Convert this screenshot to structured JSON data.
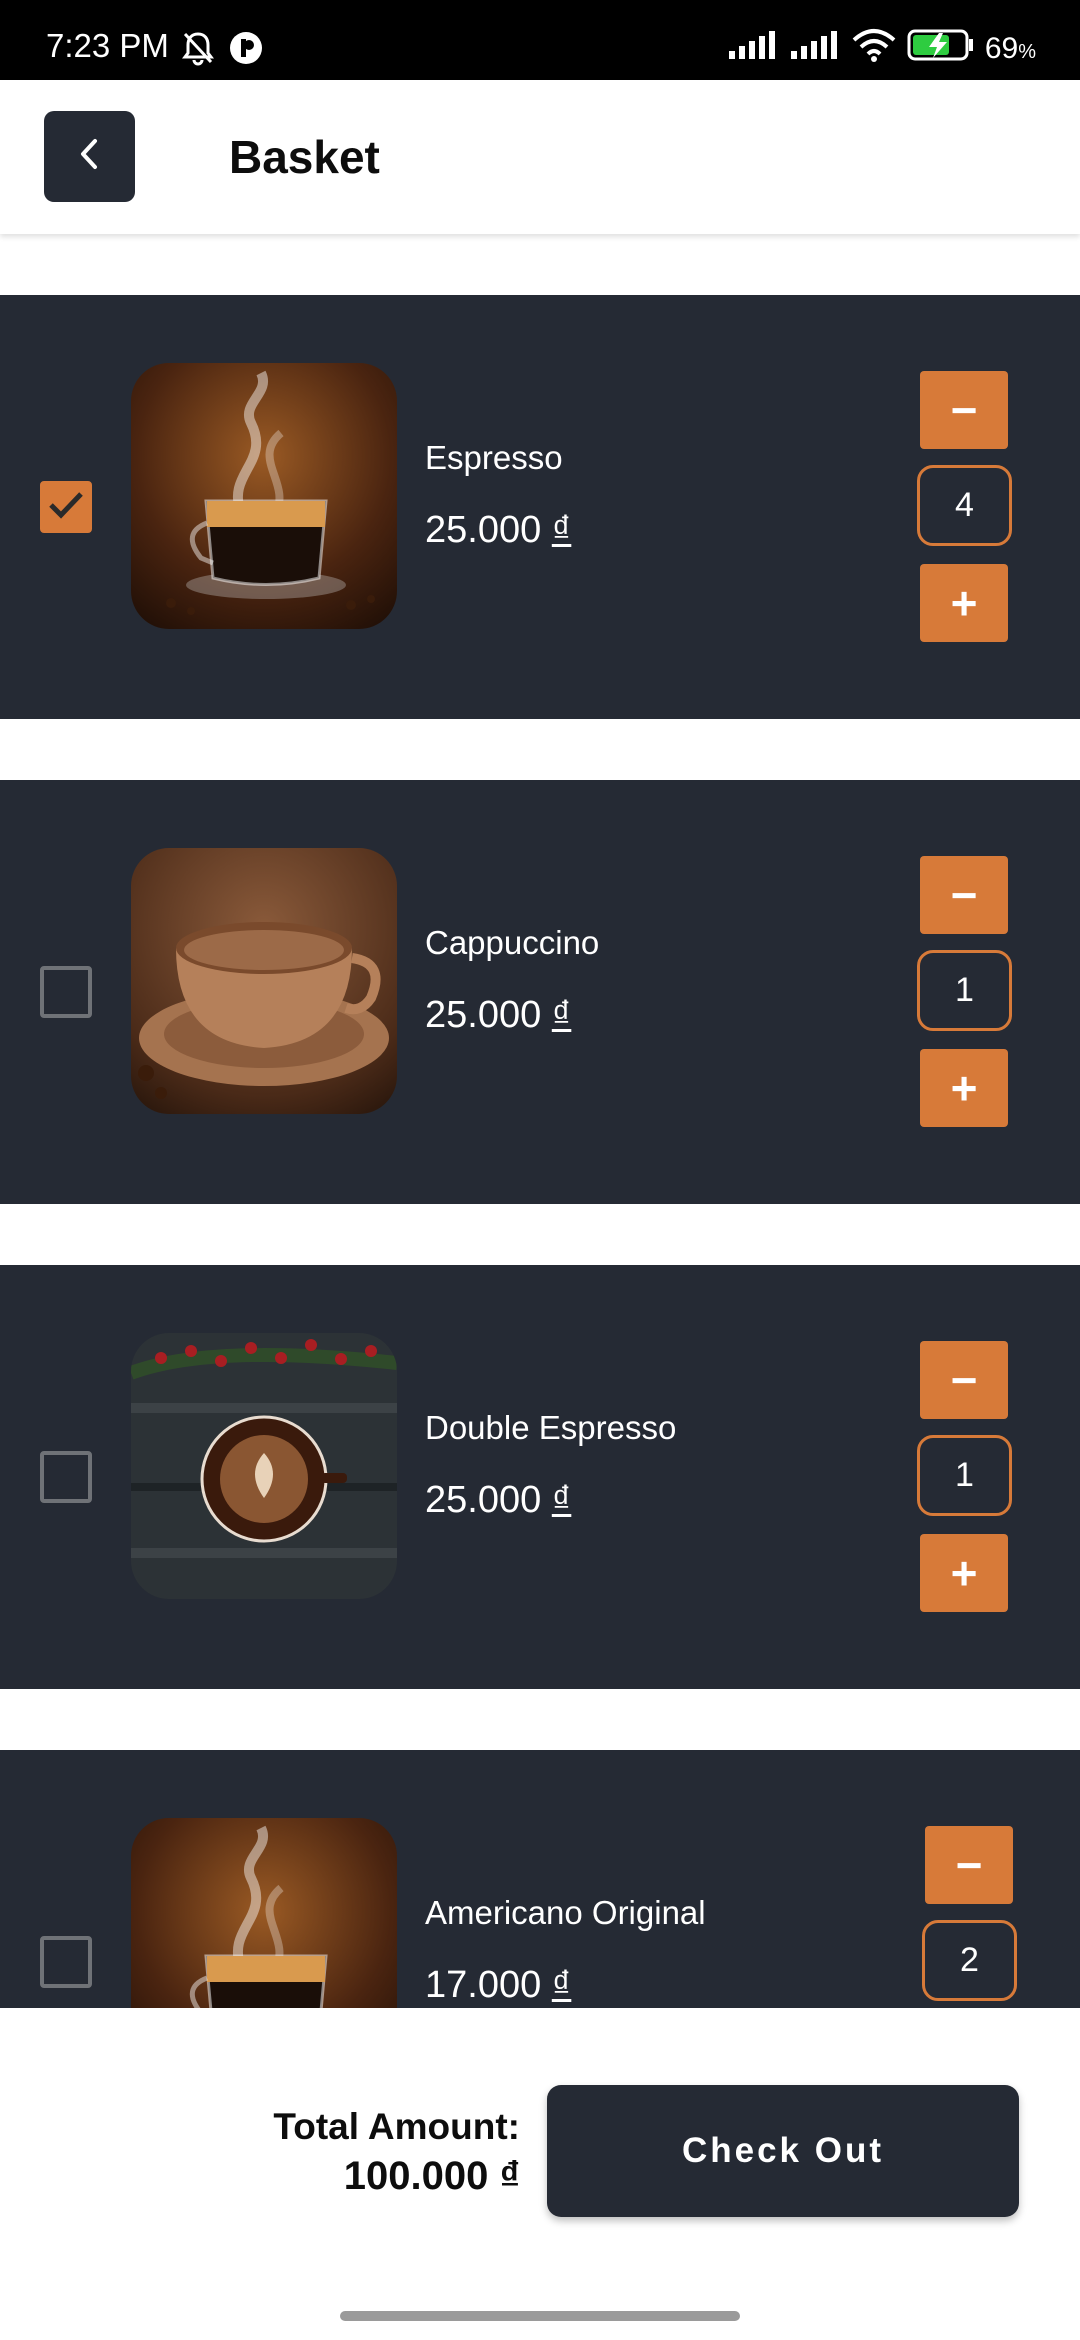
{
  "status_bar": {
    "time": "7:23 PM",
    "battery_percent": "69",
    "battery_unit": "%",
    "icons": [
      "bell-off-icon",
      "app-notification-icon",
      "signal-icon",
      "signal-icon",
      "wifi-icon",
      "battery-charging-icon"
    ]
  },
  "header": {
    "title": "Basket",
    "back_icon": "chevron-left-icon"
  },
  "colors": {
    "accent": "#d77a39",
    "card_background": "#252a34",
    "text_light": "#ffffff",
    "text_dark": "#0d0d0d"
  },
  "items": [
    {
      "name": "Espresso",
      "price": "25.000",
      "currency": "₫",
      "quantity": "4",
      "checked": true,
      "image": "espresso-cup"
    },
    {
      "name": "Cappuccino",
      "price": "25.000",
      "currency": "₫",
      "quantity": "1",
      "checked": false,
      "image": "cappuccino-cup"
    },
    {
      "name": "Double Espresso",
      "price": "25.000",
      "currency": "₫",
      "quantity": "1",
      "checked": false,
      "image": "double-espresso-cup"
    },
    {
      "name": "Americano Original",
      "price": "17.000",
      "currency": "₫",
      "quantity": "2",
      "checked": false,
      "image": "americano-cup"
    }
  ],
  "qty_controls": {
    "minus": "−",
    "plus": "+"
  },
  "footer": {
    "total_label": "Total Amount:",
    "total_value": "100.000 ₫",
    "checkout_label": "Check Out"
  }
}
